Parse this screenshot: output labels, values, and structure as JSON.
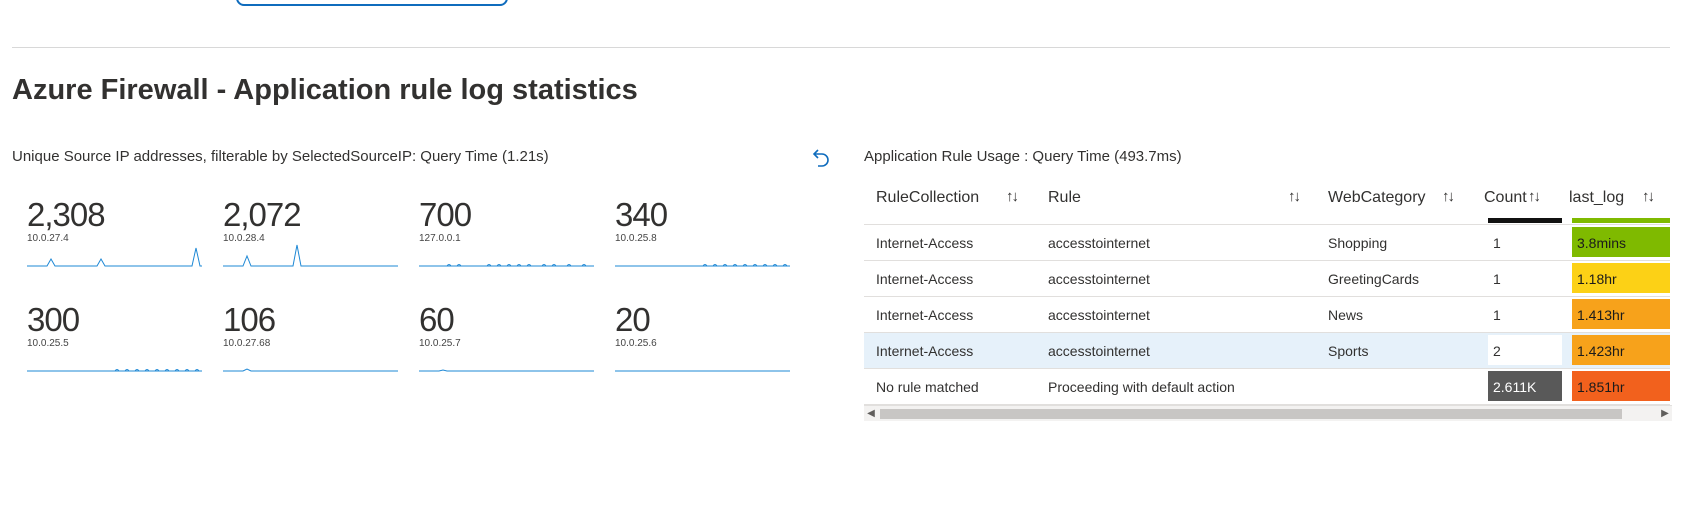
{
  "page": {
    "title": "Azure Firewall - Application rule log statistics"
  },
  "left_panel": {
    "title": "Unique Source IP addresses, filterable by SelectedSourceIP: Query Time (1.21s)",
    "tiles": [
      {
        "value": "2,308",
        "ip": "10.0.27.4"
      },
      {
        "value": "2,072",
        "ip": "10.0.28.4"
      },
      {
        "value": "700",
        "ip": "127.0.0.1"
      },
      {
        "value": "340",
        "ip": "10.0.25.8"
      },
      {
        "value": "300",
        "ip": "10.0.25.5"
      },
      {
        "value": "106",
        "ip": "10.0.27.68"
      },
      {
        "value": "60",
        "ip": "10.0.25.7"
      },
      {
        "value": "20",
        "ip": "10.0.25.6"
      }
    ]
  },
  "right_panel": {
    "title": "Application Rule Usage : Query Time (493.7ms)",
    "columns": [
      "RuleCollection",
      "Rule",
      "WebCategory",
      "Count",
      "last_log"
    ],
    "sort_icon": "↑↓",
    "rows": [
      {
        "collection": "Internet-Access",
        "rule": "accesstointernet",
        "category": "Shopping",
        "count": "1",
        "last_log": "3.8mins",
        "log_color": "#7fba00",
        "count_bg": "#ffffff",
        "count_fg": "#323130"
      },
      {
        "collection": "Internet-Access",
        "rule": "accesstointernet",
        "category": "GreetingCards",
        "count": "1",
        "last_log": "1.18hr",
        "log_color": "#fcd116",
        "count_bg": "#ffffff",
        "count_fg": "#323130"
      },
      {
        "collection": "Internet-Access",
        "rule": "accesstointernet",
        "category": "News",
        "count": "1",
        "last_log": "1.413hr",
        "log_color": "#f7a21b",
        "count_bg": "#ffffff",
        "count_fg": "#323130"
      },
      {
        "collection": "Internet-Access",
        "rule": "accesstointernet",
        "category": "Sports",
        "count": "2",
        "last_log": "1.423hr",
        "log_color": "#f7a21b",
        "count_bg": "#ffffff",
        "count_fg": "#323130"
      },
      {
        "collection": "No rule matched",
        "rule": "Proceeding with default action",
        "category": "",
        "count": "2.611K",
        "last_log": "1.851hr",
        "log_color": "#f2611d",
        "count_bg": "#595959",
        "count_fg": "#ffffff"
      }
    ]
  },
  "icons": {
    "undo": "undo-icon",
    "sort": "sort-arrows-icon",
    "scroll_left": "◀",
    "scroll_right": "▶"
  }
}
